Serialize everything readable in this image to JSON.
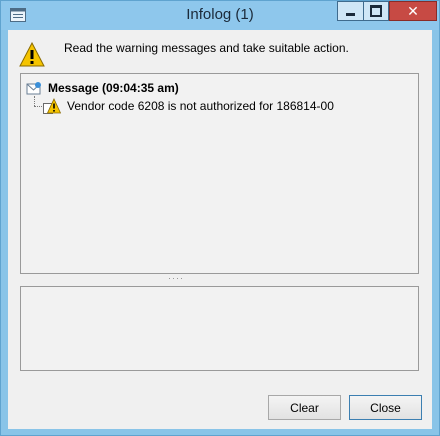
{
  "window": {
    "title": "Infolog (1)",
    "close_glyph": "✕",
    "accent_color": "#8ec7ec",
    "close_color": "#c74a44"
  },
  "instruction": "Read the warning messages and take suitable action.",
  "tree": {
    "root_label": "Message (09:04:35 am)",
    "root_icon": "message-icon",
    "children": [
      {
        "label": "Vendor code 6208 is not authorized for 186814-00",
        "icon": "warning-icon"
      }
    ]
  },
  "splitter_grip": "····",
  "buttons": {
    "clear": "Clear",
    "close": "Close"
  }
}
